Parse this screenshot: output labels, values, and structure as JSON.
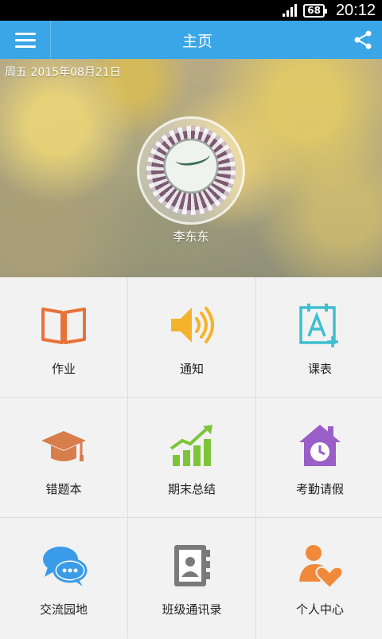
{
  "status_bar": {
    "battery": "68",
    "time": "20:12"
  },
  "app_bar": {
    "title": "主页"
  },
  "banner": {
    "date": "周五 2015年08月21日",
    "user_name": "李东东"
  },
  "grid": {
    "items": [
      {
        "label": "作业",
        "icon": "book-icon",
        "color": "#e8733a"
      },
      {
        "label": "通知",
        "icon": "speaker-icon",
        "color": "#f4b32a"
      },
      {
        "label": "课表",
        "icon": "calendar-icon",
        "color": "#3fbfd0"
      },
      {
        "label": "错题本",
        "icon": "graduation-cap-icon",
        "color": "#d87d4c"
      },
      {
        "label": "期末总结",
        "icon": "growth-chart-icon",
        "color": "#7dc43a"
      },
      {
        "label": "考勤请假",
        "icon": "house-clock-icon",
        "color": "#9a5ec8"
      },
      {
        "label": "交流园地",
        "icon": "chat-bubbles-icon",
        "color": "#3a9be8"
      },
      {
        "label": "班级通讯录",
        "icon": "contacts-book-icon",
        "color": "#7a7a7a"
      },
      {
        "label": "个人中心",
        "icon": "person-heart-icon",
        "color": "#f08a3a"
      }
    ]
  }
}
